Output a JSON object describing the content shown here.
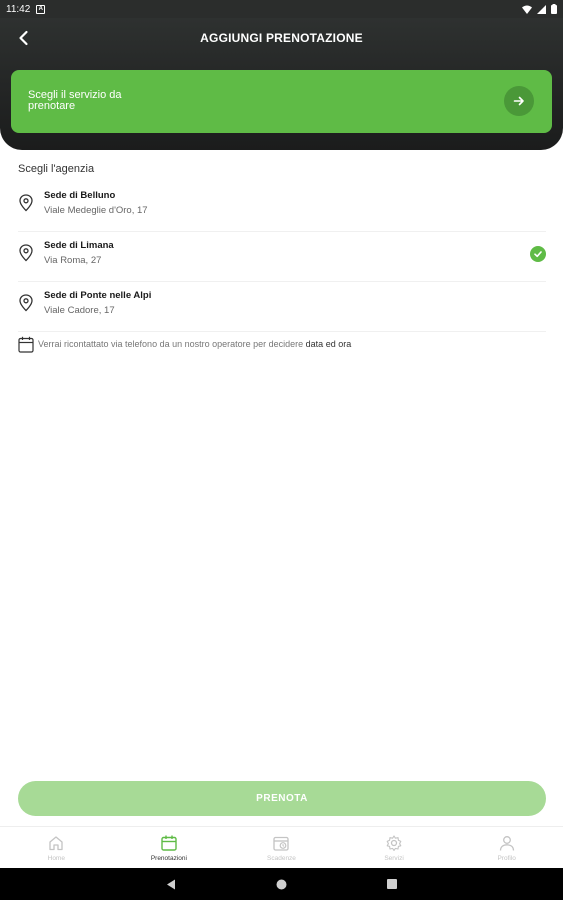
{
  "status_bar": {
    "time": "11:42",
    "notification": "A"
  },
  "header": {
    "title": "AGGIUNGI PRENOTAZIONE",
    "back_icon": "chevron-left-icon"
  },
  "service_card": {
    "label": "Scegli il servizio da prenotare",
    "arrow_icon": "arrow-right-icon",
    "color": "#5fbb46"
  },
  "agency_section": {
    "label": "Scegli l'agenzia",
    "agencies": [
      {
        "name": "Sede di Belluno",
        "address": "Viale Medeglie d'Oro, 17",
        "selected": false
      },
      {
        "name": "Sede di Limana",
        "address": "Via Roma, 27",
        "selected": true
      },
      {
        "name": "Sede di Ponte nelle Alpi",
        "address": "Viale Cadore, 17",
        "selected": false
      }
    ]
  },
  "note": {
    "prefix": "Verrai ricontattato via telefono da un nostro operatore per decidere ",
    "strong": "data ed ora"
  },
  "book_button": {
    "label": "PRENOTA",
    "color": "#a7da96"
  },
  "tabbar": {
    "tabs": [
      {
        "label": "Home",
        "icon": "home-icon",
        "active": false
      },
      {
        "label": "Prenotazioni",
        "icon": "calendar-icon",
        "active": true
      },
      {
        "label": "Scadenze",
        "icon": "scadenze-icon",
        "active": false
      },
      {
        "label": "Servizi",
        "icon": "gear-icon",
        "active": false
      },
      {
        "label": "Profilo",
        "icon": "user-icon",
        "active": false
      }
    ]
  }
}
